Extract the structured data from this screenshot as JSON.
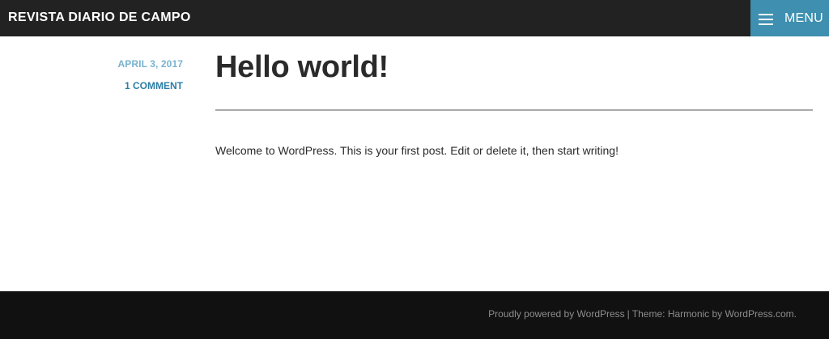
{
  "header": {
    "site_title": "REVISTA DIARIO DE CAMPO",
    "menu_label": "MENU",
    "menu_icon": "hamburger-icon",
    "accent_color": "#3e8fb0",
    "bar_color": "#222222"
  },
  "post": {
    "date": "APRIL 3, 2017",
    "comments": "1 COMMENT",
    "title": "Hello world!",
    "content": "Welcome to WordPress. This is your first post. Edit or delete it, then start writing!"
  },
  "footer": {
    "powered_by": "Proudly powered by WordPress",
    "separator": "|",
    "theme_prefix": "Theme: Harmonic by",
    "theme_author": "WordPress.com",
    "theme_suffix": "."
  }
}
